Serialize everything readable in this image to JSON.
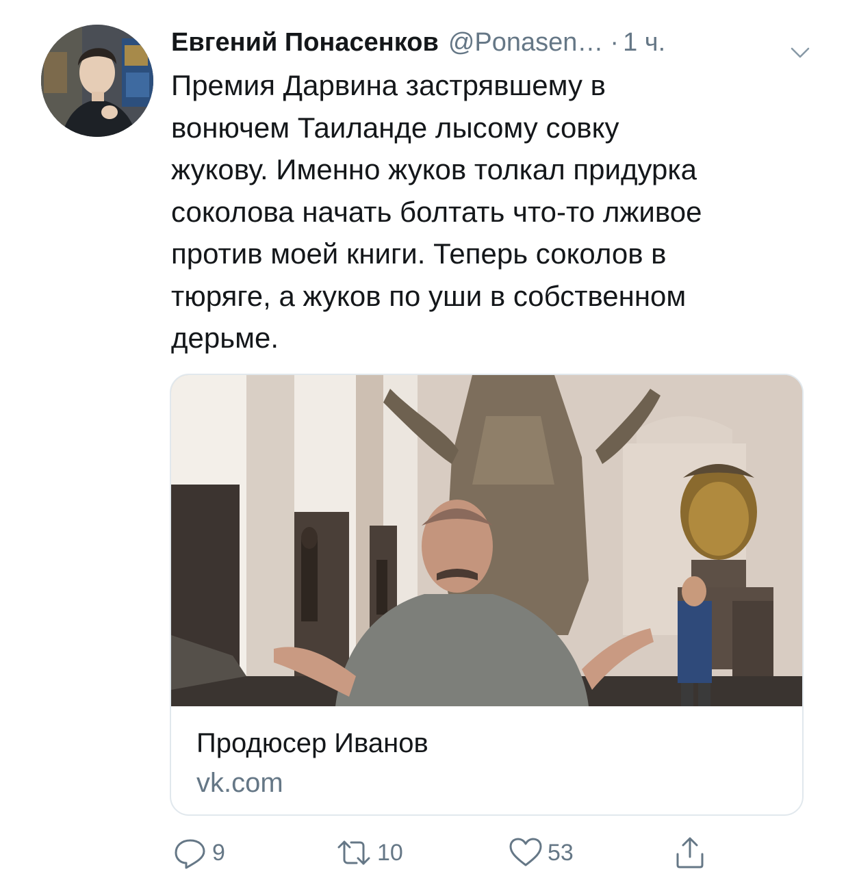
{
  "tweet": {
    "display_name": "Евгений Понасенков",
    "handle": "@Ponasen…",
    "separator": "·",
    "time": "1 ч.",
    "avatar_icon": "user-avatar",
    "menu_icon": "chevron-down-icon",
    "text_lines": [
      "Премия Дарвина застрявшему в",
      "вонючем Таиланде лысому совку",
      "жукову. Именно жуков толкал придурка",
      "соколова начать болтать что-то лживое",
      "против моей книги. Теперь соколов в",
      "тюряге, а жуков по уши в собственном",
      "дерьме."
    ]
  },
  "card": {
    "title": "Продюсер Иванов",
    "domain": "vk.com",
    "image_icon": "link-preview-photo"
  },
  "actions": {
    "reply": {
      "icon": "reply-icon",
      "count": "9"
    },
    "retweet": {
      "icon": "retweet-icon",
      "count": "10"
    },
    "like": {
      "icon": "heart-icon",
      "count": "53"
    },
    "share": {
      "icon": "share-icon"
    }
  },
  "colors": {
    "text_primary": "#14171a",
    "text_secondary": "#657786",
    "border": "#e1e8ed"
  }
}
